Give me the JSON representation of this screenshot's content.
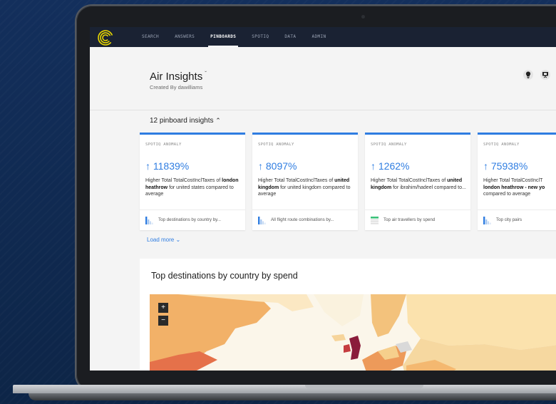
{
  "nav": {
    "items": [
      "SEARCH",
      "ANSWERS",
      "PINBOARDS",
      "SPOTIQ",
      "DATA",
      "ADMIN"
    ],
    "active": "PINBOARDS"
  },
  "header": {
    "title": "Air Insights",
    "subtitle": "Created By dawilliams",
    "icons": [
      "lightbulb-icon",
      "present-icon"
    ]
  },
  "insights": {
    "label": "12 pinboard insights",
    "cards": [
      {
        "tag": "SPOTIQ ANOMALY",
        "value": "11839%",
        "desc_pre": "Higher Total TotalCostInclTaxes of ",
        "desc_bold": "london heathrow",
        "desc_post": " for united states compared to average",
        "footer": "Top destinations by country by..."
      },
      {
        "tag": "SPOTIQ ANOMALY",
        "value": "8097%",
        "desc_pre": "Higher Total TotalCostInclTaxes of ",
        "desc_bold": "united kingdom",
        "desc_post": " for united kingdom compared to average",
        "footer": "All flight route combinations by..."
      },
      {
        "tag": "SPOTIQ ANOMALY",
        "value": "1262%",
        "desc_pre": "Higher Total TotalCostInclTaxes of ",
        "desc_bold": "united kingdom",
        "desc_post": " for ibrahim/hadeel compared to...",
        "footer": "Top air travellers by spend"
      },
      {
        "tag": "SPOTIQ ANOMALY",
        "value": "75938%",
        "desc_pre": "Higher Total TotalCostInclT",
        "desc_bold": "london heathrow - new yo",
        "desc_post": " compared to average",
        "footer": "Top city pairs"
      }
    ],
    "load_more": "Load more"
  },
  "panel": {
    "title": "Top destinations by country by spend",
    "zoom_in": "+",
    "zoom_out": "−"
  },
  "colors": {
    "accent": "#2f7de1",
    "nav_bg": "#1a2233"
  }
}
